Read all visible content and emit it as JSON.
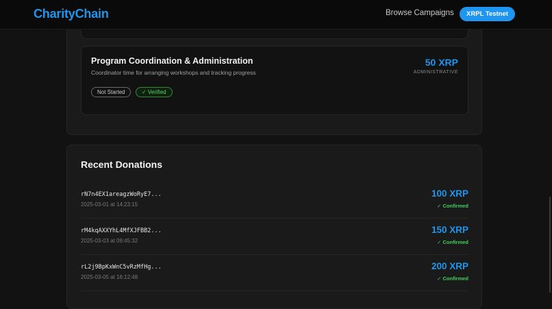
{
  "header": {
    "logo": "CharityChain",
    "nav_browse": "Browse Campaigns",
    "network_button": "XRPL Testnet"
  },
  "milestone": {
    "title": "Program Coordination & Administration",
    "description": "Coordinator time for arranging workshops and tracking progress",
    "amount": "50 XRP",
    "category": "ADMINISTRATIVE",
    "status_badge": "Not Started",
    "verified_badge": "✓ Verified"
  },
  "donations": {
    "title": "Recent Donations",
    "items": [
      {
        "address": "rN7n4EX1areagzWoRyE7...",
        "time": "2025-03-01 at 14:23:15",
        "amount": "100 XRP",
        "status": "✓ Confirmed"
      },
      {
        "address": "rM4kqAXXYhL4MfXJFBB2...",
        "time": "2025-03-03 at 09:45:32",
        "amount": "150 XRP",
        "status": "✓ Confirmed"
      },
      {
        "address": "rL2j9BpKxWnC5vRzMfHg...",
        "time": "2025-03-05 at 16:12:48",
        "amount": "200 XRP",
        "status": "✓ Confirmed"
      }
    ]
  },
  "colors": {
    "accent": "#1e96f0",
    "success": "#3ed15a",
    "background": "#121212",
    "panel": "#1a1a1a"
  }
}
